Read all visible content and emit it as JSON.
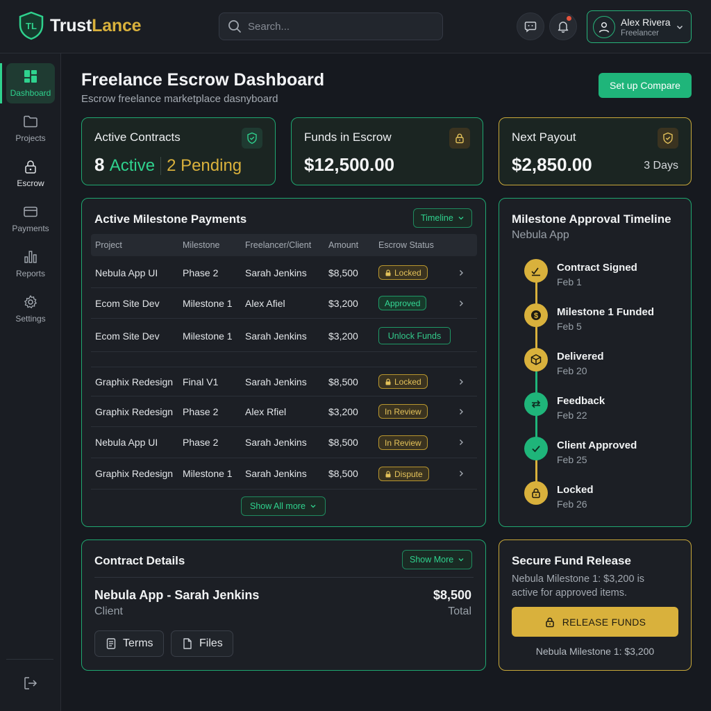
{
  "app": {
    "name_part1": "Trust",
    "name_part2": "Lance",
    "logo_letters": "TL"
  },
  "search": {
    "placeholder": "Search..."
  },
  "user": {
    "name": "Alex Rivera",
    "role": "Freelancer"
  },
  "sidebar": {
    "items": [
      {
        "label": "Dashboard",
        "icon": "dashboard-icon",
        "active": true
      },
      {
        "label": "Projects",
        "icon": "folder-icon"
      },
      {
        "label": "Escrow",
        "icon": "lock-icon"
      },
      {
        "label": "Payments",
        "icon": "wallet-icon"
      },
      {
        "label": "Reports",
        "icon": "bar-chart-icon"
      },
      {
        "label": "Settings",
        "icon": "gear-icon"
      }
    ]
  },
  "header": {
    "title": "Freelance Escrow Dashboard",
    "subtitle": "Escrow freelance marketplace dasnyboard",
    "cta": "Set up Compare"
  },
  "stats": {
    "contracts": {
      "title": "Active Contracts",
      "active_count": "8",
      "active_label": "Active",
      "pending": "2 Pending"
    },
    "escrow": {
      "title": "Funds in Escrow",
      "value": "$12,500.00"
    },
    "payout": {
      "title": "Next Payout",
      "value": "$2,850.00",
      "eta": "3 Days"
    }
  },
  "milestones": {
    "title": "Active Milestone Payments",
    "filter_label": "Timeline",
    "columns": [
      "Project",
      "Milestone",
      "Freelancer/Client",
      "Amount",
      "Escrow Status"
    ],
    "rows": [
      {
        "project": "Nebula App UI",
        "milestone": "Phase 2",
        "person": "Sarah Jenkins",
        "amount": "$8,500",
        "status": "Locked",
        "kind": "locked"
      },
      {
        "project": "Ecom Site Dev",
        "milestone": "Milestone 1",
        "person": "Alex Afiel",
        "amount": "$3,200",
        "status": "Approved",
        "kind": "approved"
      },
      {
        "project": "Ecom Site Dev",
        "milestone": "Milestone 1",
        "person": "Sarah Jenkins",
        "amount": "$3,200",
        "status": "Unlock Funds",
        "kind": "button"
      },
      {
        "project": "Graphix Redesign",
        "milestone": "Final V1",
        "person": "Sarah Jenkins",
        "amount": "$8,500",
        "status": "Locked",
        "kind": "locked"
      },
      {
        "project": "Graphix Redesign",
        "milestone": "Phase 2",
        "person": "Alex Rfiel",
        "amount": "$3,200",
        "status": "In Review",
        "kind": "review"
      },
      {
        "project": "Nebula App UI",
        "milestone": "Phase 2",
        "person": "Sarah Jenkins",
        "amount": "$8,500",
        "status": "In Review",
        "kind": "review"
      },
      {
        "project": "Graphix Redesign",
        "milestone": "Milestone 1",
        "person": "Sarah Jenkins",
        "amount": "$8,500",
        "status": "Dispute",
        "kind": "dispute"
      }
    ],
    "show_all": "Show All more"
  },
  "timeline": {
    "title": "Milestone Approval Timeline",
    "subtitle": "Nebula App",
    "steps": [
      {
        "label": "Contract Signed",
        "date": "Feb 1",
        "icon": "signature-icon",
        "color": "gold"
      },
      {
        "label": "Milestone 1 Funded",
        "date": "Feb 5",
        "icon": "dollar-icon",
        "color": "gold"
      },
      {
        "label": "Delivered",
        "date": "Feb 20",
        "icon": "box-icon",
        "color": "gold"
      },
      {
        "label": "Feedback",
        "date": "Feb 22",
        "icon": "swap-icon",
        "color": "green"
      },
      {
        "label": "Client Approved",
        "date": "Feb 25",
        "icon": "check-icon",
        "color": "green"
      },
      {
        "label": "Locked",
        "date": "Feb 26",
        "icon": "lock-icon",
        "color": "gold"
      }
    ]
  },
  "contract": {
    "title": "Contract Details",
    "show_more": "Show More",
    "name": "Nebula App - Sarah Jenkins",
    "role": "Client",
    "amount": "$8,500",
    "amount_label": "Total",
    "terms": "Terms",
    "files": "Files"
  },
  "release": {
    "title": "Secure Fund Release",
    "text": "Nebula Milestone 1: $3,200 is active for approved items.",
    "button": "RELEASE FUNDS",
    "footer": "Nebula Milestone 1: $3,200"
  },
  "colors": {
    "green": "#1fb57a",
    "gold": "#d9b13c",
    "background": "#16191f",
    "panel": "#1c1f25"
  }
}
